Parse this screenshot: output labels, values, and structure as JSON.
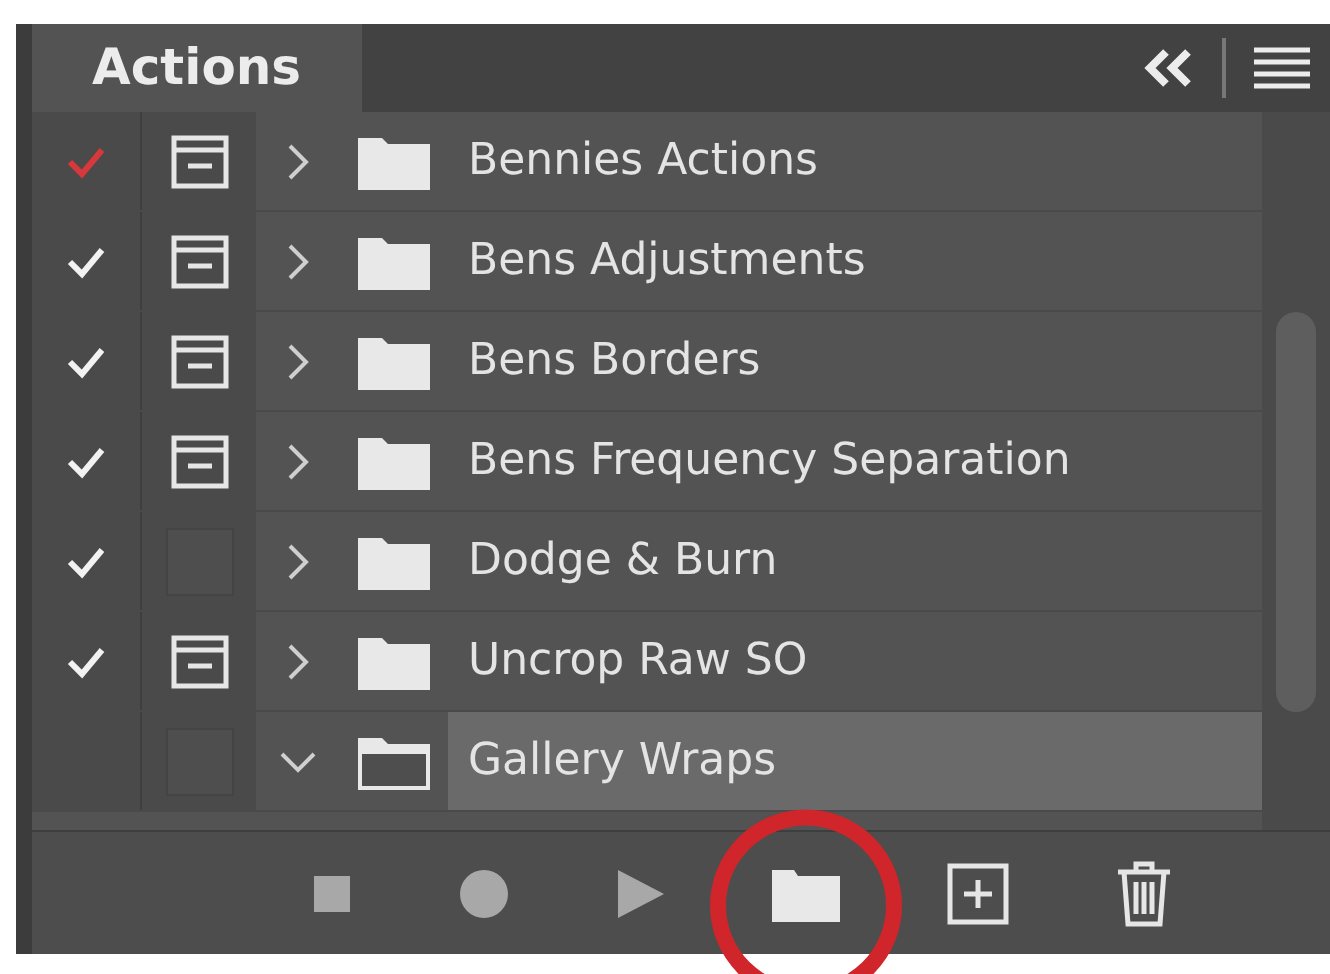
{
  "panel": {
    "title": "Actions"
  },
  "sets": [
    {
      "name": "Bennies Actions",
      "checked": true,
      "color": "#d8383b",
      "dialog": true,
      "expanded": false,
      "selected": false
    },
    {
      "name": "Bens Adjustments",
      "checked": true,
      "color": "#f2f2f2",
      "dialog": true,
      "expanded": false,
      "selected": false
    },
    {
      "name": "Bens Borders",
      "checked": true,
      "color": "#f2f2f2",
      "dialog": true,
      "expanded": false,
      "selected": false
    },
    {
      "name": "Bens Frequency Separation",
      "checked": true,
      "color": "#f2f2f2",
      "dialog": true,
      "expanded": false,
      "selected": false
    },
    {
      "name": "Dodge & Burn",
      "checked": true,
      "color": "#f2f2f2",
      "dialog": false,
      "expanded": false,
      "selected": false
    },
    {
      "name": "Uncrop Raw SO",
      "checked": true,
      "color": "#f2f2f2",
      "dialog": true,
      "expanded": false,
      "selected": false
    },
    {
      "name": "Gallery Wraps",
      "checked": false,
      "dialog": false,
      "expanded": true,
      "selected": true
    }
  ],
  "toolbar": [
    {
      "kind": "stop"
    },
    {
      "kind": "record"
    },
    {
      "kind": "play"
    },
    {
      "kind": "new-set",
      "highlighted": true
    },
    {
      "kind": "new-action"
    },
    {
      "kind": "delete"
    }
  ]
}
